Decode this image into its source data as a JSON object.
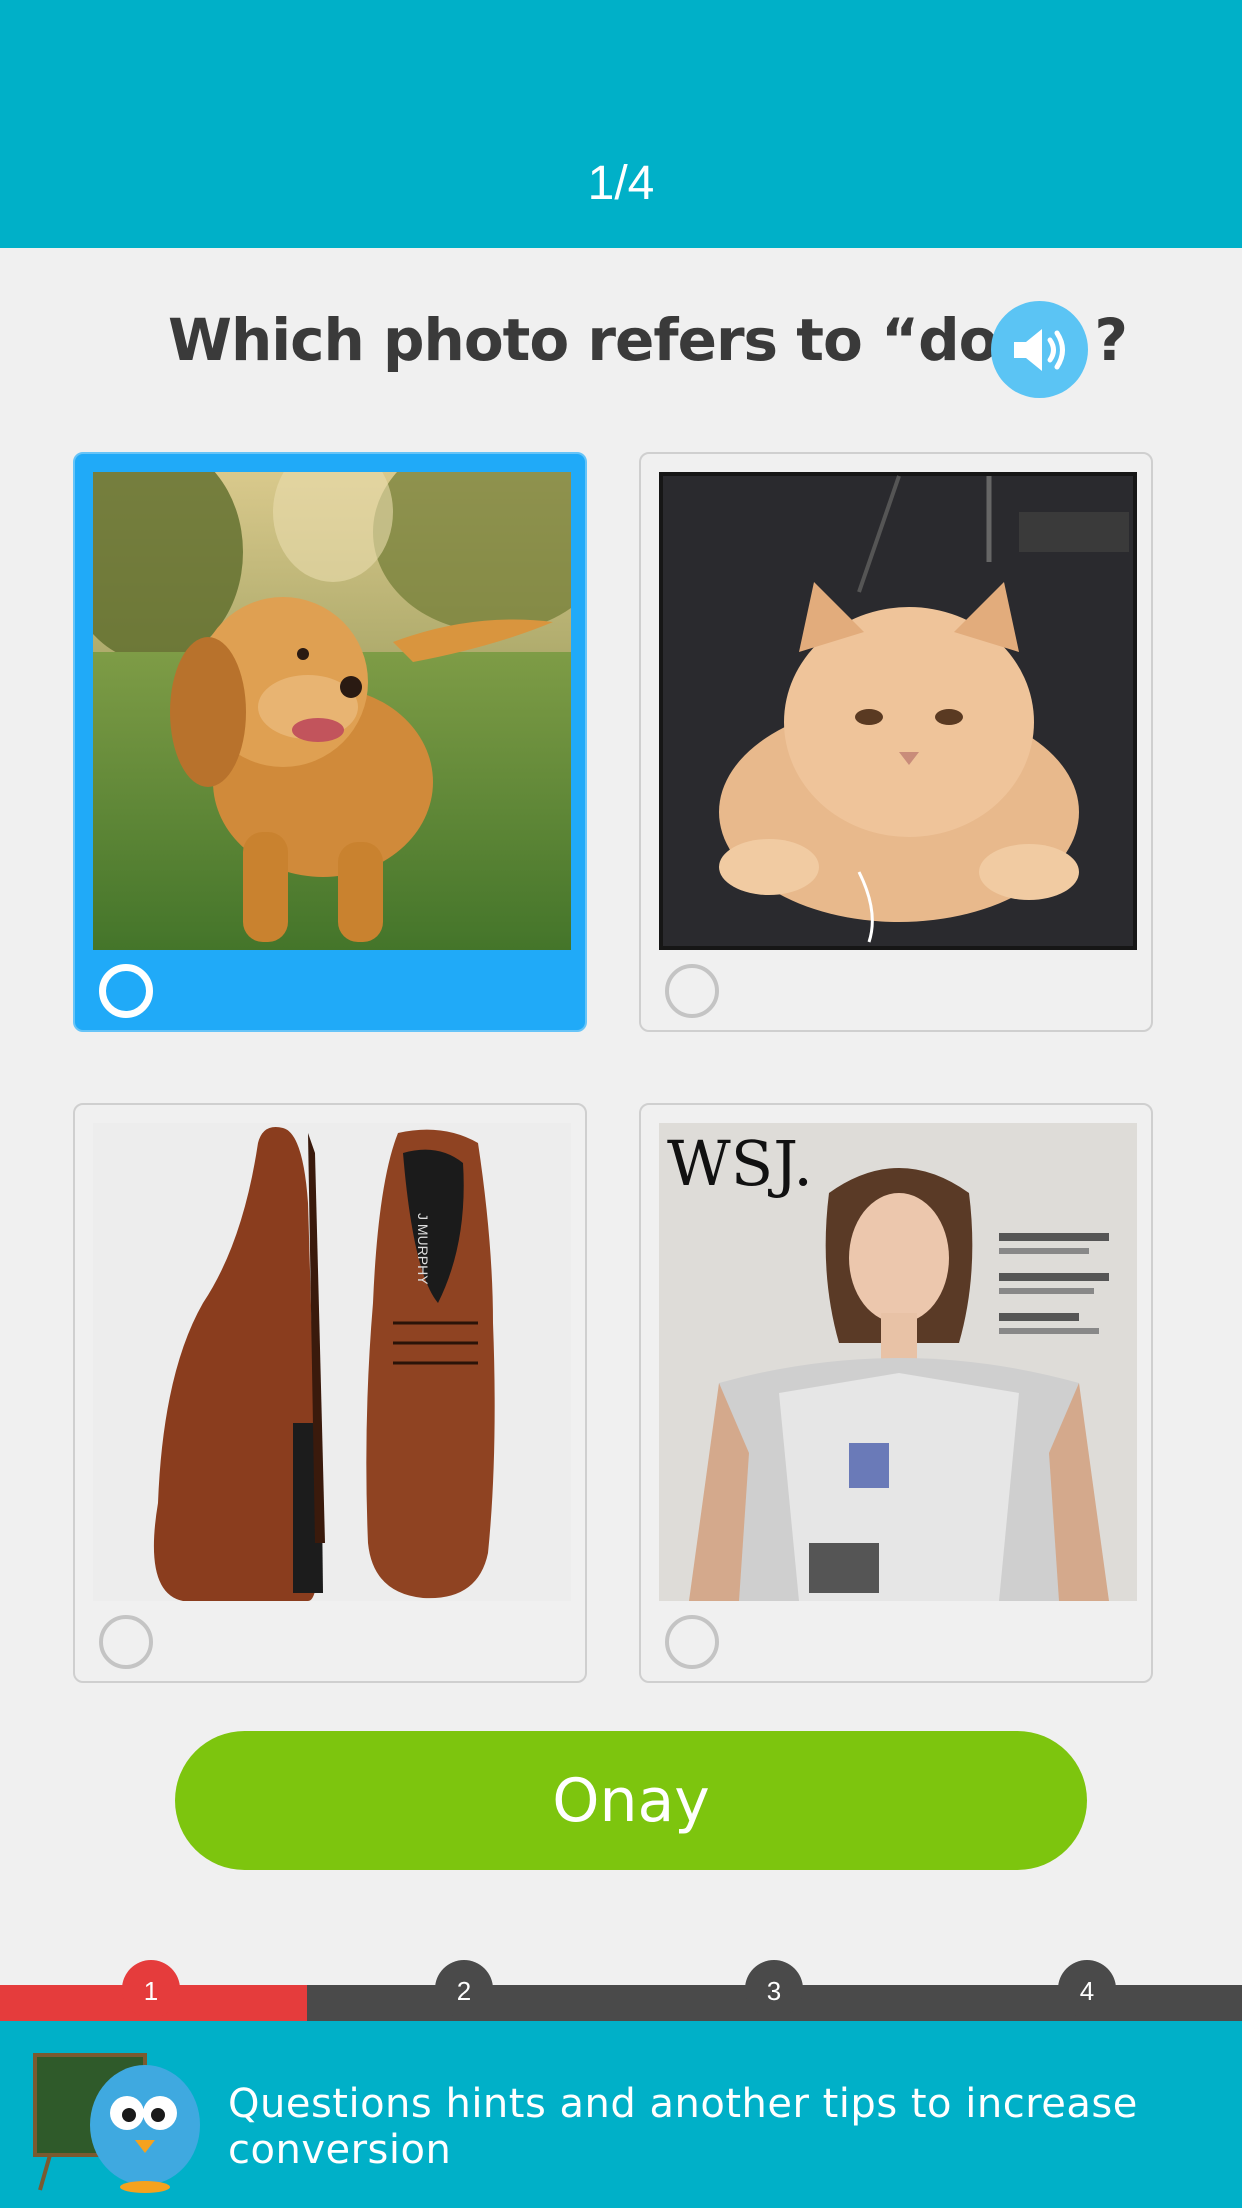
{
  "header": {
    "progress": "1/4",
    "background_color": "#00b0c8"
  },
  "question": {
    "text": "Which photo refers to “dog” ?",
    "audio_icon": "speaker-icon"
  },
  "options": [
    {
      "subject": "dog",
      "selected": true
    },
    {
      "subject": "cat",
      "selected": false
    },
    {
      "subject": "shoes",
      "selected": false
    },
    {
      "subject": "woman on magazine cover",
      "selected": false,
      "cover_text": "WSJ."
    }
  ],
  "confirm_button": {
    "label": "Onay",
    "color": "#7dc50e"
  },
  "stepper": {
    "steps": [
      "1",
      "2",
      "3",
      "4"
    ],
    "current": 1,
    "active_color": "#e53c3c"
  },
  "footer": {
    "hint": "Questions hints and another tips to increase conversion",
    "mascot_icon": "bird-teacher-mascot-icon"
  }
}
